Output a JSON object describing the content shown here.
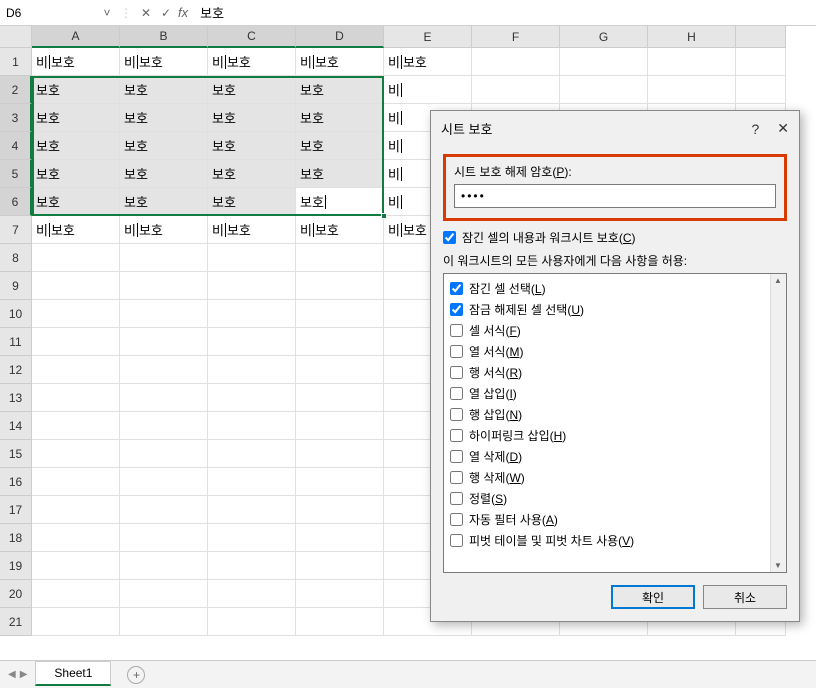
{
  "formula_bar": {
    "name_box": "D6",
    "formula_value": "보호"
  },
  "columns": [
    "A",
    "B",
    "C",
    "D",
    "E",
    "F",
    "G",
    "H"
  ],
  "rows_count": 21,
  "cells": {
    "r1": [
      "비보호",
      "비보호",
      "비보호",
      "비보호",
      "비보호",
      "",
      "",
      "",
      ""
    ],
    "r2": [
      "보호",
      "보호",
      "보호",
      "보호",
      "비",
      "",
      "",
      "",
      ""
    ],
    "r3": [
      "보호",
      "보호",
      "보호",
      "보호",
      "비",
      "",
      "",
      "",
      ""
    ],
    "r4": [
      "보호",
      "보호",
      "보호",
      "보호",
      "비",
      "",
      "",
      "",
      ""
    ],
    "r5": [
      "보호",
      "보호",
      "보호",
      "보호",
      "비",
      "",
      "",
      "",
      ""
    ],
    "r6": [
      "보호",
      "보호",
      "보호",
      "보호",
      "비",
      "",
      "",
      "",
      ""
    ],
    "r7": [
      "비보호",
      "비보호",
      "비보호",
      "비보호",
      "비",
      "",
      "",
      "",
      ""
    ]
  },
  "active_cell_text": "보호",
  "edit_cursor_cells": [
    "B1",
    "C1",
    "D1",
    "E1",
    "A7",
    "B7",
    "C7",
    "D7",
    "E7"
  ],
  "sheet_tab": "Sheet1",
  "dialog": {
    "title": "시트 보호",
    "help": "?",
    "close": "✕",
    "pw_label_full": "시트 보호 해제 암호(P):",
    "pw_value": "••••",
    "protect_chk_full": "잠긴 셀의 내용과 워크시트 보호(C)",
    "allow_label": "이 워크시트의 모든 사용자에게 다음 사항을 허용:",
    "perms": [
      {
        "label": "잠긴 셀 선택(L)",
        "checked": true,
        "u": "L"
      },
      {
        "label": "잠금 해제된 셀 선택(U)",
        "checked": true,
        "u": "U"
      },
      {
        "label": "셀 서식(F)",
        "checked": false,
        "u": "F"
      },
      {
        "label": "열 서식(M)",
        "checked": false,
        "u": "M"
      },
      {
        "label": "행 서식(R)",
        "checked": false,
        "u": "R"
      },
      {
        "label": "열 삽입(I)",
        "checked": false,
        "u": "I"
      },
      {
        "label": "행 삽입(N)",
        "checked": false,
        "u": "N"
      },
      {
        "label": "하이퍼링크 삽입(H)",
        "checked": false,
        "u": "H"
      },
      {
        "label": "열 삭제(D)",
        "checked": false,
        "u": "D"
      },
      {
        "label": "행 삭제(W)",
        "checked": false,
        "u": "W"
      },
      {
        "label": "정렬(S)",
        "checked": false,
        "u": "S"
      },
      {
        "label": "자동 필터 사용(A)",
        "checked": false,
        "u": "A"
      },
      {
        "label": "피벗 테이블 및 피벗 차트 사용(V)",
        "checked": false,
        "u": "V"
      }
    ],
    "ok": "확인",
    "cancel": "취소"
  }
}
